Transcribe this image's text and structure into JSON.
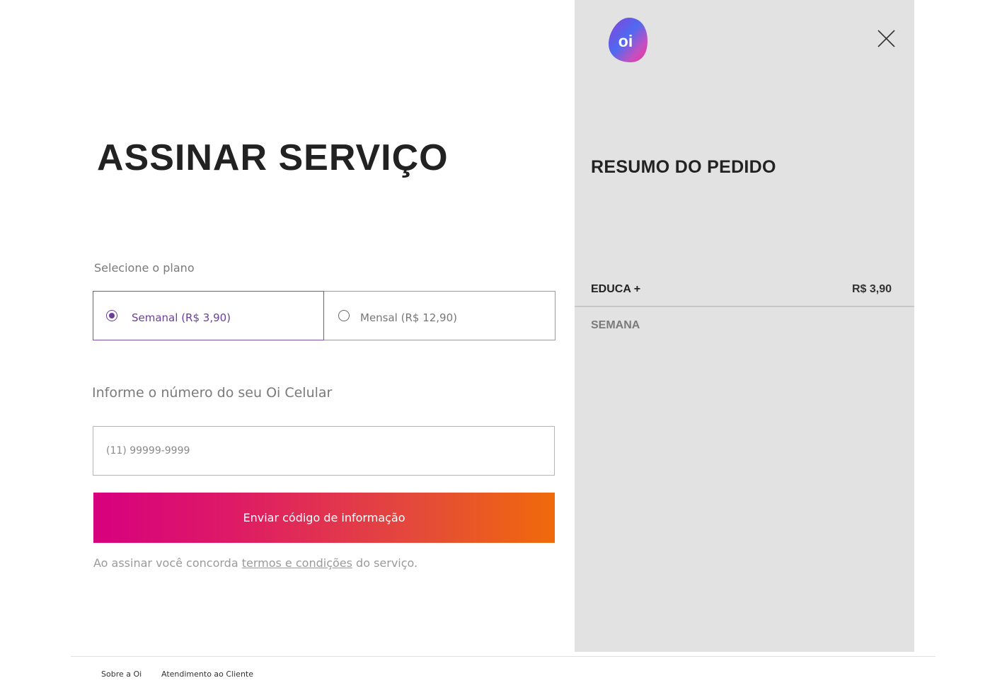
{
  "page": {
    "title": "ASSINAR SERVIÇO"
  },
  "plan": {
    "label": "Selecione o plano",
    "options": [
      {
        "label": "Semanal (R$ 3,90)",
        "selected": true
      },
      {
        "label": "Mensal (R$ 12,90)",
        "selected": false
      }
    ]
  },
  "phone": {
    "label": "Informe o número do seu Oi Celular",
    "placeholder": "(11) 99999-9999",
    "value": ""
  },
  "submit": {
    "label": "Enviar código de informação"
  },
  "terms": {
    "prefix": "Ao assinar você concorda ",
    "link": "termos e condições",
    "suffix": " do serviço."
  },
  "summary": {
    "logo_text": "oi",
    "title": "RESUMO DO PEDIDO",
    "item_name": "EDUCA +",
    "item_price": "R$ 3,90",
    "period": "SEMANA"
  },
  "footer": {
    "about": "Sobre a Oi",
    "support": "Atendimento ao Cliente"
  },
  "colors": {
    "accent_purple": "#6a3f9a",
    "gradient_start": "#d7007f",
    "gradient_end": "#f06a0a",
    "panel_bg": "#e2e2e2"
  },
  "icons": {
    "close": "close-icon",
    "radio_checked": "radio-checked-icon",
    "radio_unchecked": "radio-unchecked-icon",
    "logo": "oi-logo"
  }
}
